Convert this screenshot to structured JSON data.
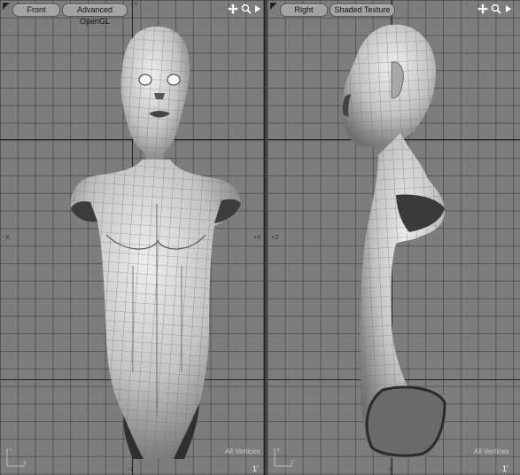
{
  "left_viewport": {
    "view_label": "Front",
    "shading_label": "Advanced OpenGL",
    "axis_top": "+Y",
    "axis_bottom": "-Y",
    "axis_left": "-X",
    "axis_right": "+X",
    "status": "All Vertices",
    "scale": "1'"
  },
  "right_viewport": {
    "view_label": "Right",
    "shading_label": "Shaded Texture",
    "axis_left": "+Z",
    "axis_bottom": "-Y",
    "status": "All Vertices",
    "scale": "1'"
  },
  "colors": {
    "viewport_bg": "#7d7d7d",
    "grid_line": "#5a5a5a",
    "axis_line": "#1e1e1e",
    "tag_bg": "#a3a3a3",
    "model_surface": "#c8c8c8",
    "model_wire": "#6e6e6e",
    "status_text": "#c9c9c9"
  },
  "icons": [
    "menu-triangle-icon",
    "move-icon",
    "zoom-icon",
    "expand-arrow-icon"
  ]
}
